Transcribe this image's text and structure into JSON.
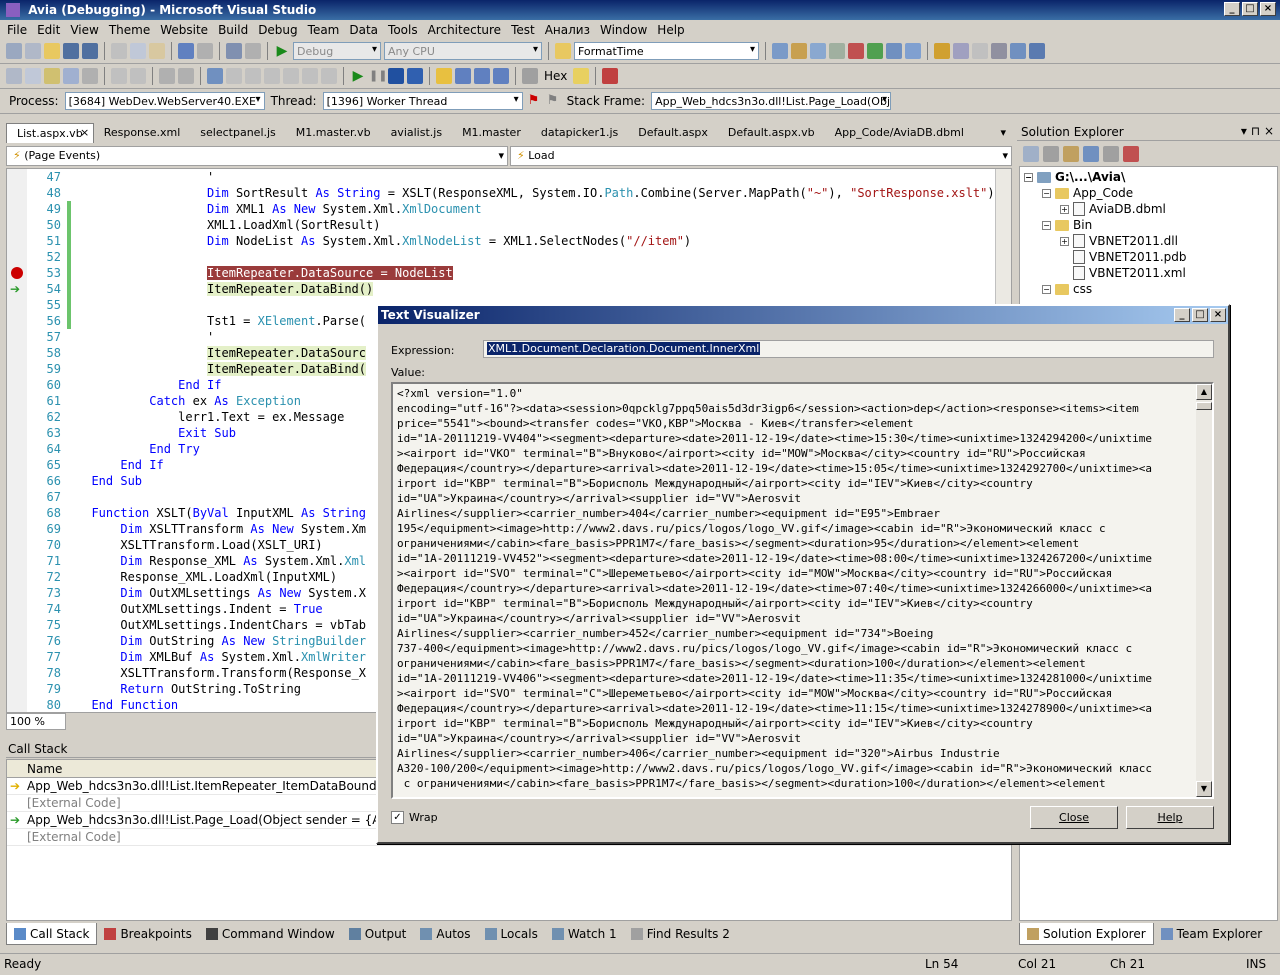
{
  "window": {
    "title": "Avia (Debugging) - Microsoft Visual Studio"
  },
  "menu": [
    "File",
    "Edit",
    "View",
    "Theme",
    "Website",
    "Build",
    "Debug",
    "Team",
    "Data",
    "Tools",
    "Architecture",
    "Test",
    "Анализ",
    "Window",
    "Help"
  ],
  "toolbar": {
    "config": "Debug",
    "platform": "Any CPU",
    "format_combo": "FormatTime",
    "hex_label": "Hex"
  },
  "debugbar": {
    "process_label": "Process:",
    "process_value": "[3684] WebDev.WebServer40.EXE",
    "thread_label": "Thread:",
    "thread_value": "[1396] Worker Thread",
    "stack_frame_label": "Stack Frame:",
    "stack_frame_value": "App_Web_hdcs3n3o.dll!List.Page_Load(Objec"
  },
  "doc_tabs": [
    "List.aspx.vb",
    "Response.xml",
    "selectpanel.js",
    "M1.master.vb",
    "avialist.js",
    "M1.master",
    "datapicker1.js",
    "Default.aspx",
    "Default.aspx.vb",
    "App_Code/AviaDB.dbml"
  ],
  "editor": {
    "left_dropdown": "(Page Events)",
    "right_dropdown": "Load",
    "zoom": "100 %"
  },
  "code_lines": [
    {
      "n": "47",
      "html": "                  '"
    },
    {
      "n": "48",
      "html": "                  <span class=\"kw\">Dim</span> SortResult <span class=\"kw\">As String</span> = XSLT(ResponseXML, System.IO.<span class=\"ty\">Path</span>.Combine(Server.MapPath(<span class=\"st\">\"~\"</span>), <span class=\"st\">\"SortResponse.xslt\"</span>))"
    },
    {
      "n": "49",
      "html": "                  <span class=\"kw\">Dim</span> XML1 <span class=\"kw\">As New</span> System.Xml.<span class=\"ty\">XmlDocument</span>",
      "g": true
    },
    {
      "n": "50",
      "html": "                  XML1.LoadXml(SortResult)",
      "g": true
    },
    {
      "n": "51",
      "html": "                  <span class=\"kw\">Dim</span> NodeList <span class=\"kw\">As</span> System.Xml.<span class=\"ty\">XmlNodeList</span> = XML1.SelectNodes(<span class=\"st\">\"//item\"</span>)",
      "g": true
    },
    {
      "n": "52",
      "html": "",
      "g": true
    },
    {
      "n": "53",
      "html": "                  <span class=\"bp\">ItemRepeater.DataSource = NodeList</span>",
      "g": true,
      "bp": true
    },
    {
      "n": "54",
      "html": "                  <span class=\"cur\">ItemRepeater.DataBind()</span>",
      "g": true,
      "ip": true
    },
    {
      "n": "55",
      "html": "",
      "g": true
    },
    {
      "n": "56",
      "html": "                  Tst1 = <span class=\"ty\">XElement</span>.Parse(",
      "g": true
    },
    {
      "n": "57",
      "html": "                  '"
    },
    {
      "n": "58",
      "html": "                  <span class=\"cur\">ItemRepeater.DataSourc</span>"
    },
    {
      "n": "59",
      "html": "                  <span class=\"cur\">ItemRepeater.DataBind(</span>"
    },
    {
      "n": "60",
      "html": "              <span class=\"kw\">End If</span>"
    },
    {
      "n": "61",
      "html": "          <span class=\"kw\">Catch</span> ex <span class=\"kw\">As</span> <span class=\"ty\">Exception</span>"
    },
    {
      "n": "62",
      "html": "              lerr1.Text = ex.Message"
    },
    {
      "n": "63",
      "html": "              <span class=\"kw\">Exit Sub</span>"
    },
    {
      "n": "64",
      "html": "          <span class=\"kw\">End Try</span>"
    },
    {
      "n": "65",
      "html": "      <span class=\"kw\">End If</span>"
    },
    {
      "n": "66",
      "html": "  <span class=\"kw\">End Sub</span>"
    },
    {
      "n": "67",
      "html": ""
    },
    {
      "n": "68",
      "html": "  <span class=\"kw\">Function</span> XSLT(<span class=\"kw\">ByVal</span> InputXML <span class=\"kw\">As String</span>"
    },
    {
      "n": "69",
      "html": "      <span class=\"kw\">Dim</span> XSLTTransform <span class=\"kw\">As New</span> System.Xm"
    },
    {
      "n": "70",
      "html": "      XSLTTransform.Load(XSLT_URI)"
    },
    {
      "n": "71",
      "html": "      <span class=\"kw\">Dim</span> Response_XML <span class=\"kw\">As</span> System.Xml.<span class=\"ty\">Xml</span>"
    },
    {
      "n": "72",
      "html": "      Response_XML.LoadXml(InputXML)"
    },
    {
      "n": "73",
      "html": "      <span class=\"kw\">Dim</span> OutXMLsettings <span class=\"kw\">As New</span> System.X"
    },
    {
      "n": "74",
      "html": "      OutXMLsettings.Indent = <span class=\"kw\">True</span>"
    },
    {
      "n": "75",
      "html": "      OutXMLsettings.IndentChars = vbTab"
    },
    {
      "n": "76",
      "html": "      <span class=\"kw\">Dim</span> OutString <span class=\"kw\">As New</span> <span class=\"ty\">StringBuilder</span>"
    },
    {
      "n": "77",
      "html": "      <span class=\"kw\">Dim</span> XMLBuf <span class=\"kw\">As</span> System.Xml.<span class=\"ty\">XmlWriter</span>"
    },
    {
      "n": "78",
      "html": "      XSLTTransform.Transform(Response_X"
    },
    {
      "n": "79",
      "html": "      <span class=\"kw\">Return</span> OutString.ToString"
    },
    {
      "n": "80",
      "html": "  <span class=\"kw\">End Function</span>"
    }
  ],
  "callstack": {
    "title": "Call Stack",
    "column": "Name",
    "rows": [
      {
        "text": "App_Web_hdcs3n3o.dll!List.ItemRepeater_ItemDataBound(Object",
        "mark": "yellow"
      },
      {
        "text": "[External Code]",
        "ext": true
      },
      {
        "text": "App_Web_hdcs3n3o.dll!List.Page_Load(Object sender = {ASP.list_a",
        "mark": "green"
      },
      {
        "text": "[External Code]",
        "ext": true
      }
    ]
  },
  "bottom_tabs": [
    "Call Stack",
    "Breakpoints",
    "Command Window",
    "Output",
    "Autos",
    "Locals",
    "Watch 1",
    "Find Results 2"
  ],
  "solution_explorer": {
    "title": "Solution Explorer",
    "root": "G:\\...\\Avia\\",
    "nodes": [
      {
        "label": "App_Code",
        "type": "folder",
        "level": 1,
        "exp": "-"
      },
      {
        "label": "AviaDB.dbml",
        "type": "file",
        "level": 2,
        "exp": "+"
      },
      {
        "label": "Bin",
        "type": "folder",
        "level": 1,
        "exp": "-"
      },
      {
        "label": "VBNET2011.dll",
        "type": "file",
        "level": 2,
        "exp": "+"
      },
      {
        "label": "VBNET2011.pdb",
        "type": "file",
        "level": 2,
        "exp": ""
      },
      {
        "label": "VBNET2011.xml",
        "type": "file",
        "level": 2,
        "exp": ""
      },
      {
        "label": "css",
        "type": "folder",
        "level": 1,
        "exp": "-"
      }
    ],
    "tabs": [
      "Solution Explorer",
      "Team Explorer"
    ]
  },
  "status": {
    "ready": "Ready",
    "ln": "Ln 54",
    "col": "Col 21",
    "ch": "Ch 21",
    "ins": "INS"
  },
  "dialog": {
    "title": "Text Visualizer",
    "expression_label": "Expression:",
    "expression": "XML1.Document.Declaration.Document.InnerXml",
    "value_label": "Value:",
    "value_lines": [
      "<?xml version=\"1.0\"",
      "encoding=\"utf-16\"?><data><session>0qpcklg7ppq50ais5d3dr3igp6</session><action>dep</action><response><items><item",
      "price=\"5541\"><bound><transfer codes=\"VKO,KBP\">Москва - Киев</transfer><element",
      "id=\"1A-20111219-VV404\"><segment><departure><date>2011-12-19</date><time>15:30</time><unixtime>1324294200</unixtime",
      "><airport id=\"VKO\" terminal=\"B\">Внуково</airport><city id=\"MOW\">Москва</city><country id=\"RU\">Российская",
      "Федерация</country></departure><arrival><date>2011-12-19</date><time>15:05</time><unixtime>1324292700</unixtime><a",
      "irport id=\"KBP\" terminal=\"B\">Борисполь Международный</airport><city id=\"IEV\">Киев</city><country",
      "id=\"UA\">Украина</country></arrival><supplier id=\"VV\">Aerosvit",
      "Airlines</supplier><carrier_number>404</carrier_number><equipment id=\"E95\">Embraer",
      "195</equipment><image>http://www2.davs.ru/pics/logos/logo_VV.gif</image><cabin id=\"R\">Экономический класс с",
      "ограничениями</cabin><fare_basis>PPR1M7</fare_basis></segment><duration>95</duration></element><element",
      "id=\"1A-20111219-VV452\"><segment><departure><date>2011-12-19</date><time>08:00</time><unixtime>1324267200</unixtime",
      "><airport id=\"SVO\" terminal=\"C\">Шереметьево</airport><city id=\"MOW\">Москва</city><country id=\"RU\">Российская",
      "Федерация</country></departure><arrival><date>2011-12-19</date><time>07:40</time><unixtime>1324266000</unixtime><a",
      "irport id=\"KBP\" terminal=\"B\">Борисполь Международный</airport><city id=\"IEV\">Киев</city><country",
      "id=\"UA\">Украина</country></arrival><supplier id=\"VV\">Aerosvit",
      "Airlines</supplier><carrier_number>452</carrier_number><equipment id=\"734\">Boeing",
      "737-400</equipment><image>http://www2.davs.ru/pics/logos/logo_VV.gif</image><cabin id=\"R\">Экономический класс с",
      "ограничениями</cabin><fare_basis>PPR1M7</fare_basis></segment><duration>100</duration></element><element",
      "id=\"1A-20111219-VV406\"><segment><departure><date>2011-12-19</date><time>11:35</time><unixtime>1324281000</unixtime",
      "><airport id=\"SVO\" terminal=\"C\">Шереметьево</airport><city id=\"MOW\">Москва</city><country id=\"RU\">Российская",
      "Федерация</country></departure><arrival><date>2011-12-19</date><time>11:15</time><unixtime>1324278900</unixtime><a",
      "irport id=\"KBP\" terminal=\"B\">Борисполь Международный</airport><city id=\"IEV\">Киев</city><country",
      "id=\"UA\">Украина</country></arrival><supplier id=\"VV\">Aerosvit",
      "Airlines</supplier><carrier_number>406</carrier_number><equipment id=\"320\">Airbus Industrie",
      "A320-100/200</equipment><image>http://www2.davs.ru/pics/logos/logo_VV.gif</image><cabin id=\"R\">Экономический класс",
      " с ограничениями</cabin><fare_basis>PPR1M7</fare_basis></segment><duration>100</duration></element><element"
    ],
    "wrap_label": "Wrap",
    "wrap_checked": true,
    "close_label": "Close",
    "help_label": "Help"
  }
}
